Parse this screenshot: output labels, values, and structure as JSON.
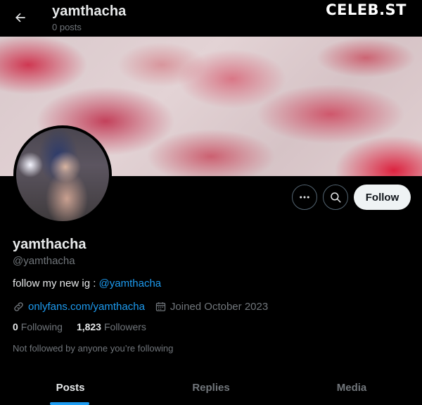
{
  "header": {
    "title": "yamthacha",
    "subtitle": "0 posts",
    "watermark": "CELEB.ST"
  },
  "profile": {
    "display_name": "yamthacha",
    "handle": "@yamthacha",
    "bio_text": "follow my new ig : ",
    "bio_mention": "@yamthacha",
    "website": "onlyfans.com/yamthacha",
    "joined": "Joined October 2023",
    "following_count": "0",
    "following_label": "Following",
    "followers_count": "1,823",
    "followers_label": "Followers",
    "not_followed_text": "Not followed by anyone you’re following"
  },
  "actions": {
    "follow_label": "Follow"
  },
  "tabs": [
    {
      "label": "Posts",
      "active": true
    },
    {
      "label": "Replies",
      "active": false
    },
    {
      "label": "Media",
      "active": false
    }
  ],
  "icons": {
    "back": "arrow-left-icon",
    "more": "more-horizontal-icon",
    "search": "search-icon",
    "link": "link-icon",
    "calendar": "calendar-icon"
  },
  "colors": {
    "background": "#000000",
    "accent": "#1d9bf0",
    "text_primary": "#e7e9ea",
    "text_secondary": "#71767b",
    "follow_button_bg": "#eff3f4"
  }
}
